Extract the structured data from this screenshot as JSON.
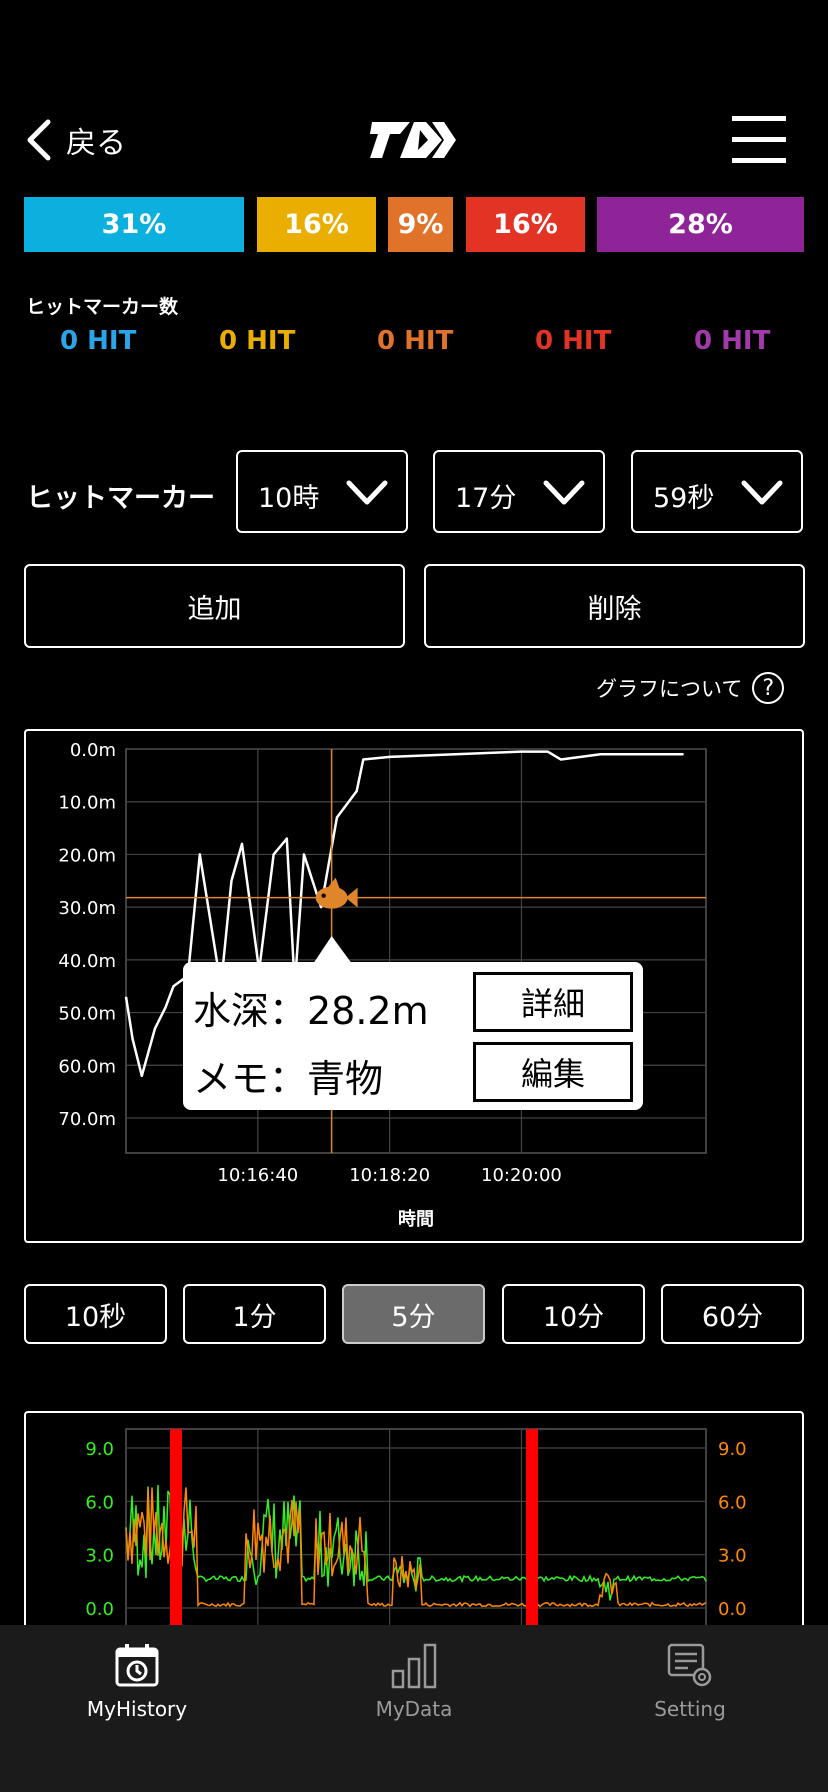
{
  "header": {
    "back_label": "戻る",
    "logo": "daiwa-logo",
    "menu_icon": "hamburger-icon"
  },
  "ratio_segments": [
    {
      "label": "31%",
      "color": "#0bb0de"
    },
    {
      "label": "16%",
      "color": "#e9ae00"
    },
    {
      "label": "9%",
      "color": "#e0722a"
    },
    {
      "label": "16%",
      "color": "#e23325"
    },
    {
      "label": "28%",
      "color": "#8f2398"
    }
  ],
  "hit_markers": {
    "title": "ヒットマーカー数",
    "counts": [
      {
        "label": "0 HIT",
        "color": "#2aa6e8"
      },
      {
        "label": "0 HIT",
        "color": "#e9ae00"
      },
      {
        "label": "0 HIT",
        "color": "#e0722a"
      },
      {
        "label": "0 HIT",
        "color": "#e23325"
      },
      {
        "label": "0 HIT",
        "color": "#a23aab"
      }
    ]
  },
  "marker_select": {
    "label": "ヒットマーカー",
    "hour": "10時",
    "minute": "17分",
    "second": "59秒"
  },
  "actions": {
    "add_label": "追加",
    "delete_label": "削除"
  },
  "graph_help": {
    "label": "グラフについて",
    "icon": "?"
  },
  "popup": {
    "depth_line": "水深：28.2m",
    "memo_line": "メモ：青物",
    "detail_label": "詳細",
    "edit_label": "編集"
  },
  "chart_data": [
    {
      "type": "line",
      "ylabel": "",
      "xlabel": "時間",
      "y_ticks": [
        "0.0m",
        "10.0m",
        "20.0m",
        "30.0m",
        "40.0m",
        "50.0m",
        "60.0m",
        "70.0m"
      ],
      "ylim": [
        0,
        75
      ],
      "y_inverted": true,
      "x_ticks": [
        "10:16:40",
        "10:18:20",
        "10:20:00"
      ],
      "x_seconds_from_start": [
        0,
        5,
        12,
        22,
        30,
        36,
        47,
        56,
        72,
        80,
        88,
        101,
        112,
        122,
        128,
        135,
        148,
        160,
        175,
        180,
        200,
        250,
        300,
        320,
        330,
        360,
        400,
        423
      ],
      "x_tick_seconds": [
        100,
        200,
        300
      ],
      "series": [
        {
          "color": "#ffffff",
          "values": [
            47,
            55,
            62,
            53,
            49,
            45,
            43,
            20,
            45,
            25,
            18,
            42,
            20,
            17,
            45,
            20,
            30,
            13,
            8,
            2,
            1.5,
            1,
            0.5,
            0.5,
            2,
            1,
            1,
            1
          ]
        }
      ],
      "hit_marker": {
        "time": "10:17:59",
        "depth": 28.2,
        "x_seconds": 156,
        "icon": "fish-icon",
        "color": "#e0862a"
      }
    },
    {
      "type": "bar",
      "y_ticks_left": [
        "9.0",
        "6.0",
        "3.0",
        "0.0"
      ],
      "y_ticks_right": [
        "9.0",
        "6.0",
        "3.0",
        "0.0"
      ],
      "ylim": [
        0,
        10
      ],
      "series": [
        {
          "name": "",
          "color": "#ff8800"
        },
        {
          "name": "",
          "color": "#33ee22"
        },
        {
          "name": "",
          "color": "#ff0000"
        }
      ]
    }
  ],
  "range_buttons": [
    {
      "label": "10秒",
      "active": false
    },
    {
      "label": "1分",
      "active": false
    },
    {
      "label": "5分",
      "active": true
    },
    {
      "label": "10分",
      "active": false
    },
    {
      "label": "60分",
      "active": false
    }
  ],
  "tabbar": [
    {
      "label": "MyHistory",
      "icon": "calendar-history-icon",
      "color": "#ffffff"
    },
    {
      "label": "MyData",
      "icon": "bar-chart-icon",
      "color": "#9a9a9a"
    },
    {
      "label": "Setting",
      "icon": "settings-sliders-icon",
      "color": "#9a9a9a"
    }
  ]
}
